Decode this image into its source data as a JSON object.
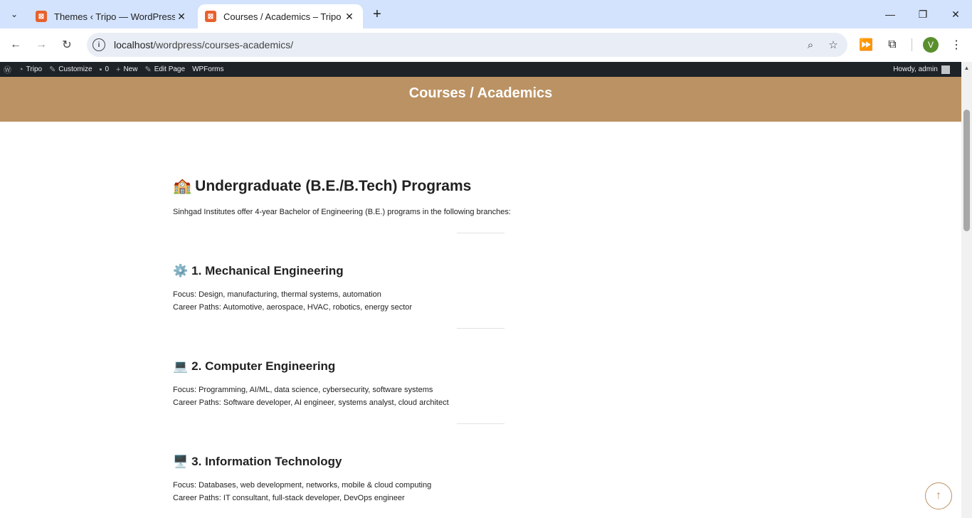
{
  "browser": {
    "tabs": [
      {
        "title": "Themes ‹ Tripo — WordPress",
        "active": false
      },
      {
        "title": "Courses / Academics – Tripo",
        "active": true
      }
    ],
    "url_host": "localhost",
    "url_path": "/wordpress/courses-academics/",
    "profile_initial": "V"
  },
  "adminbar": {
    "site": "Tripo",
    "customize": "Customize",
    "comments": "0",
    "new": "New",
    "edit": "Edit Page",
    "wpforms": "WPForms",
    "howdy": "Howdy, admin"
  },
  "page": {
    "banner_title": "Courses / Academics",
    "heading": "Undergraduate (B.E./B.Tech) Programs",
    "heading_emoji": "🏫",
    "intro": "Sinhgad Institutes offer 4-year Bachelor of Engineering (B.E.) programs in the following branches:",
    "branches": [
      {
        "emoji": "⚙️",
        "title": "1. Mechanical Engineering",
        "focus": "Focus: Design, manufacturing, thermal systems, automation",
        "careers": "Career Paths: Automotive, aerospace, HVAC, robotics, energy sector"
      },
      {
        "emoji": "💻",
        "title": "2. Computer Engineering",
        "focus": "Focus: Programming, AI/ML, data science, cybersecurity, software systems",
        "careers": "Career Paths: Software developer, AI engineer, systems analyst, cloud architect"
      },
      {
        "emoji": "🖥️",
        "title": "3. Information Technology",
        "focus": "Focus: Databases, web development, networks, mobile & cloud computing",
        "careers": "Career Paths: IT consultant, full-stack developer, DevOps engineer"
      }
    ]
  },
  "colors": {
    "banner": "#bb9263",
    "adminbar": "#1d2327",
    "tabstrip": "#d3e3fd"
  }
}
